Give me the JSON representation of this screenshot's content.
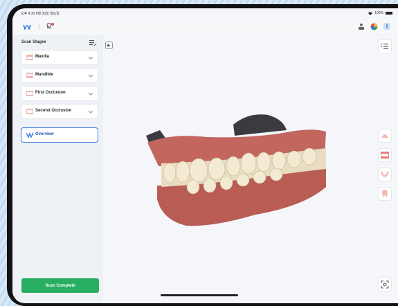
{
  "status_bar": {
    "time_date": "오후 4:30   8월 30일 월요일",
    "battery": "100%"
  },
  "sidebar": {
    "title": "Scan Stages",
    "stages": [
      {
        "label": "Maxilla",
        "active": false
      },
      {
        "label": "Mandible",
        "active": false
      },
      {
        "label": "First Occlusion",
        "active": false
      },
      {
        "label": "Second Occlusion",
        "active": false
      },
      {
        "label": "Overview",
        "active": true
      }
    ],
    "scan_complete_label": "Scan Complete"
  },
  "colors": {
    "accent": "#3d7be6",
    "complete_green": "#27ae60",
    "gum": "#c2665e",
    "tooth": "#e9dcc0"
  },
  "icons": [
    "dental-scan-logo-icon",
    "tooth-edit-icon",
    "user-group-icon",
    "color-wheel-icon",
    "info-icon",
    "settings-list-icon",
    "collapse-panel-icon",
    "view-list-icon",
    "maxilla-view-icon",
    "occlusion-view-icon",
    "mandible-view-icon",
    "single-tooth-icon",
    "fit-view-icon"
  ]
}
